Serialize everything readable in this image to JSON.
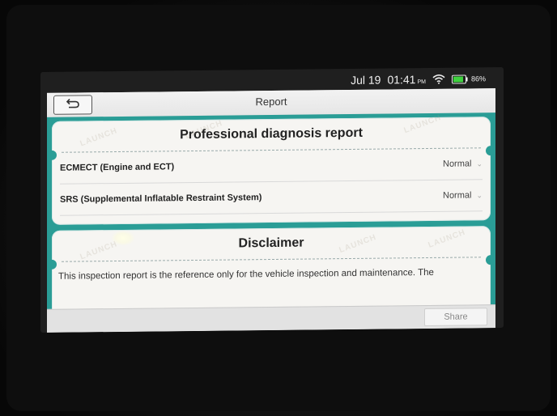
{
  "status_bar": {
    "date": "Jul 19",
    "time": "01:41",
    "time_suffix": "PM",
    "battery_percent": "86%",
    "battery_level": 0.86,
    "wifi_icon": "wifi-icon",
    "battery_icon": "battery-icon"
  },
  "titlebar": {
    "back_icon": "back-arrow-icon",
    "title": "Report"
  },
  "report_card": {
    "title": "Professional diagnosis report",
    "rows": [
      {
        "system": "ECMECT (Engine and ECT)",
        "status": "Normal"
      },
      {
        "system": "SRS (Supplemental Inflatable Restraint System)",
        "status": "Normal"
      }
    ]
  },
  "disclaimer_card": {
    "title": "Disclaimer",
    "text": "This inspection report is the reference only for the vehicle inspection and maintenance. The"
  },
  "bottombar": {
    "share_label": "Share"
  },
  "watermark": "LAUNCH",
  "colors": {
    "accent": "#2a9d96",
    "battery_fill": "#3fd13f"
  }
}
